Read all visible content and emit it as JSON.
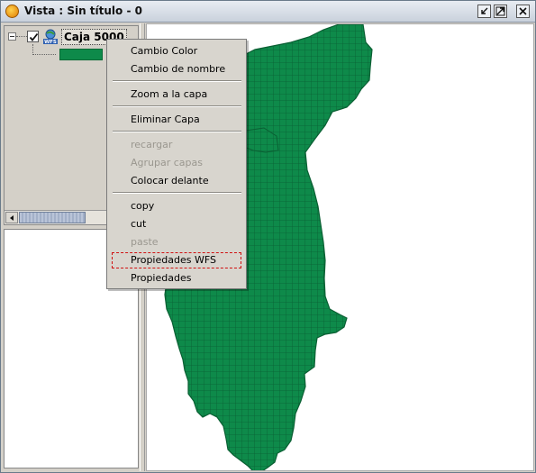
{
  "window": {
    "title": "Vista : Sin título - 0",
    "icon": "gvsig-app-icon"
  },
  "toc": {
    "layer": {
      "name": "Caja 5000",
      "checked": true,
      "icon": "wfs-layer-icon",
      "legend_color": "#0e8a4a"
    }
  },
  "context_menu": {
    "items": [
      {
        "label": "Cambio Color",
        "enabled": true
      },
      {
        "label": "Cambio de nombre",
        "enabled": true
      },
      {
        "label": "Zoom a la capa",
        "enabled": true
      },
      {
        "label": "Eliminar Capa",
        "enabled": true
      },
      {
        "label": "recargar",
        "enabled": false
      },
      {
        "label": "Agrupar capas",
        "enabled": false
      },
      {
        "label": "Colocar delante",
        "enabled": true
      },
      {
        "label": "copy",
        "enabled": true
      },
      {
        "label": "cut",
        "enabled": true
      },
      {
        "label": "paste",
        "enabled": false
      },
      {
        "label": "Propiedades WFS",
        "enabled": true,
        "focused": true
      },
      {
        "label": "Propiedades",
        "enabled": true
      }
    ]
  },
  "map": {
    "fill_color": "#0e8a4a",
    "edge_color": "#0a5f33"
  }
}
